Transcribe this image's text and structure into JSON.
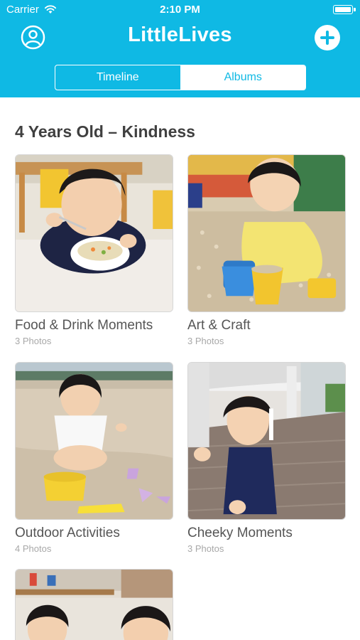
{
  "status_bar": {
    "carrier": "Carrier",
    "time": "2:10 PM"
  },
  "header": {
    "title": "LittleLives",
    "tabs": [
      {
        "label": "Timeline",
        "selected": true
      },
      {
        "label": "Albums",
        "selected": false
      }
    ]
  },
  "section": {
    "title": "4 Years Old – Kindness"
  },
  "albums": [
    {
      "name": "Food & Drink Moments",
      "count": "3 Photos"
    },
    {
      "name": "Art & Craft",
      "count": "3 Photos"
    },
    {
      "name": "Outdoor Activities",
      "count": "4 Photos"
    },
    {
      "name": "Cheeky Moments",
      "count": "3 Photos"
    },
    {
      "name": "",
      "count": ""
    }
  ],
  "colors": {
    "brand": "#0fb9e4",
    "title_text": "#404040",
    "album_text": "#555555",
    "count_text": "#a8a8a8"
  },
  "icons": [
    "wifi-icon",
    "battery-icon",
    "profile-icon",
    "add-icon"
  ]
}
